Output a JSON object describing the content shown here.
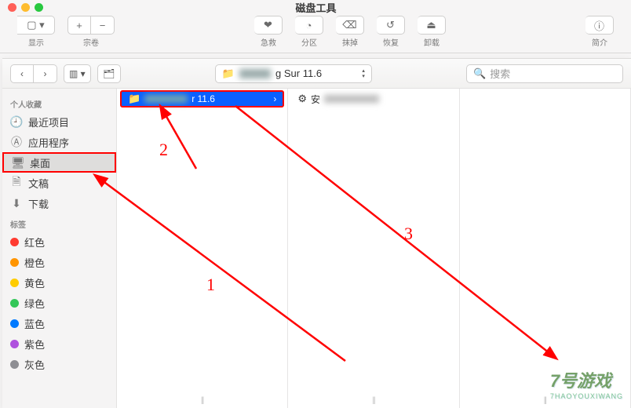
{
  "window": {
    "title": "磁盘工具"
  },
  "toolbar": {
    "view_label": "显示",
    "volume_label": "宗卷",
    "firstaid_label": "急救",
    "partition_label": "分区",
    "erase_label": "抹掉",
    "restore_label": "恢复",
    "unmount_label": "卸载",
    "info_label": "简介",
    "plus": "+",
    "minus": "−"
  },
  "finder": {
    "path_name": "g Sur 11.6",
    "search_placeholder": "搜索"
  },
  "sidebar": {
    "favorites_label": "个人收藏",
    "tags_label": "标签",
    "items": [
      {
        "icon": "clock",
        "label": "最近项目"
      },
      {
        "icon": "app",
        "label": "应用程序"
      },
      {
        "icon": "desktop",
        "label": "桌面"
      },
      {
        "icon": "doc",
        "label": "文稿"
      },
      {
        "icon": "download",
        "label": "下载"
      }
    ],
    "tags": [
      {
        "color": "#ff3b30",
        "label": "红色"
      },
      {
        "color": "#ff9500",
        "label": "橙色"
      },
      {
        "color": "#ffcc00",
        "label": "黄色"
      },
      {
        "color": "#34c759",
        "label": "绿色"
      },
      {
        "color": "#007aff",
        "label": "蓝色"
      },
      {
        "color": "#af52de",
        "label": "紫色"
      },
      {
        "color": "#8e8e93",
        "label": "灰色"
      }
    ]
  },
  "columns": {
    "col1": {
      "selected": "r 11.6"
    },
    "col2": {
      "item": "安"
    }
  },
  "annotations": {
    "n1": "1",
    "n2": "2",
    "n3": "3"
  },
  "watermark": {
    "main": "7号游戏",
    "sub": "7HAOYOUXIWANG"
  }
}
